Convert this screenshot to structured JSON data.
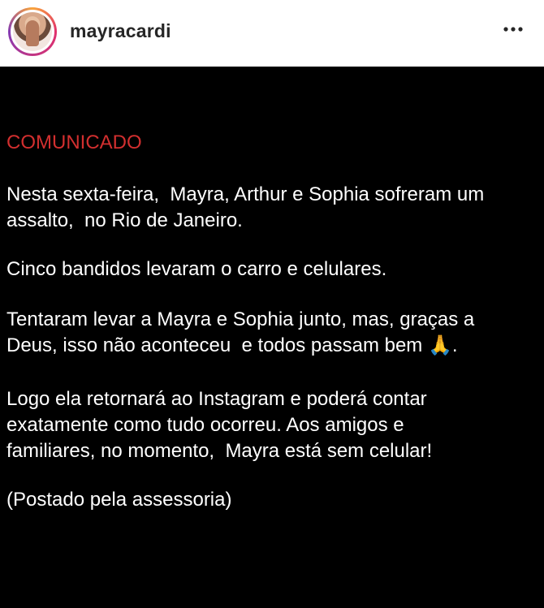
{
  "header": {
    "username": "mayracardi",
    "more_icon": "more-horizontal-icon"
  },
  "post": {
    "heading": "COMUNICADO",
    "paragraph1": "Nesta sexta-feira,  Mayra, Arthur e Sophia sofreram um\nassalto,  no Rio de Janeiro.",
    "paragraph2": "Cinco bandidos levaram o carro e celulares.",
    "paragraph3": "Tentaram levar a Mayra e Sophia junto, mas, graças a\nDeus, isso não aconteceu  e todos passam bem 🙏.",
    "paragraph4": "Logo ela retornará ao Instagram e poderá contar\nexatamente como tudo ocorreu. Aos amigos e\nfamiliares, no momento,  Mayra está sem celular!",
    "paragraph5": "(Postado pela assessoria)"
  },
  "colors": {
    "heading_red": "#d22f2f",
    "post_background": "#000000",
    "header_background": "#ffffff"
  }
}
